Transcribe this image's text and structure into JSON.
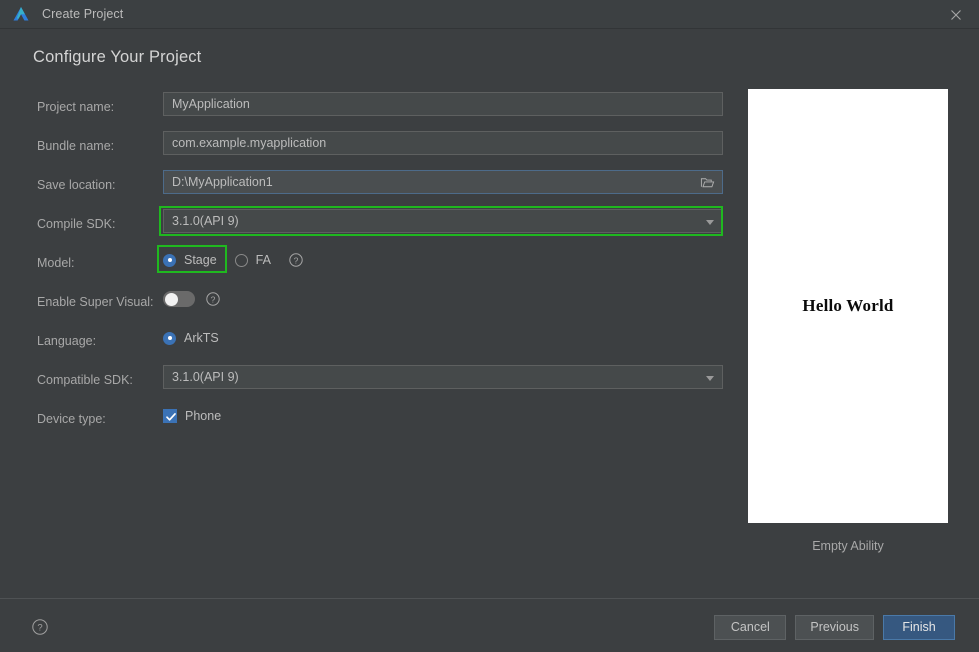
{
  "window": {
    "title": "Create Project",
    "logo_icon": "deveco-triangle-logo",
    "close_icon": "close-icon"
  },
  "page": {
    "heading": "Configure Your Project"
  },
  "form": {
    "project_name": {
      "label": "Project name:",
      "value": "MyApplication",
      "placeholder": "MyApplication"
    },
    "bundle_name": {
      "label": "Bundle name:",
      "value": "com.example.myapplication",
      "placeholder": "com.example.myapplication"
    },
    "save_location": {
      "label": "Save location:",
      "value": "D:\\MyApplication1",
      "placeholder": "D:\\MyApplication1",
      "browse_icon": "folder-open-icon"
    },
    "compile_sdk": {
      "label": "Compile SDK:",
      "value": "3.1.0(API 9)",
      "options": [
        "3.1.0(API 9)"
      ],
      "highlighted": true
    },
    "model": {
      "label": "Model:",
      "selected": "Stage",
      "options": [
        "Stage",
        "FA"
      ],
      "help_icon": "help-circle-icon",
      "highlighted": true
    },
    "enable_super_visual": {
      "label": "Enable Super Visual:",
      "state": "off",
      "help_icon": "help-circle-icon"
    },
    "language": {
      "label": "Language:",
      "selected": "ArkTS",
      "options": [
        "ArkTS"
      ]
    },
    "compatible_sdk": {
      "label": "Compatible SDK:",
      "value": "3.1.0(API 9)",
      "options": [
        "3.1.0(API 9)"
      ]
    },
    "device_type": {
      "label": "Device type:",
      "items": [
        {
          "label": "Phone",
          "checked": true
        }
      ]
    }
  },
  "preview": {
    "screen_text": "Hello World",
    "caption": "Empty Ability"
  },
  "footer": {
    "help_icon": "help-circle-icon",
    "cancel_label": "Cancel",
    "previous_label": "Previous",
    "finish_label": "Finish"
  },
  "colors": {
    "background": "#3c3f41",
    "titlebar": "#3c4042",
    "field_bg": "#45494a",
    "accent_blue": "#3b72b5",
    "primary_button": "#365880",
    "highlight_green": "#1fb81f",
    "focus_border": "#4d6b8a",
    "text": "#bcbcbc",
    "label_text": "#a8a8a8"
  }
}
